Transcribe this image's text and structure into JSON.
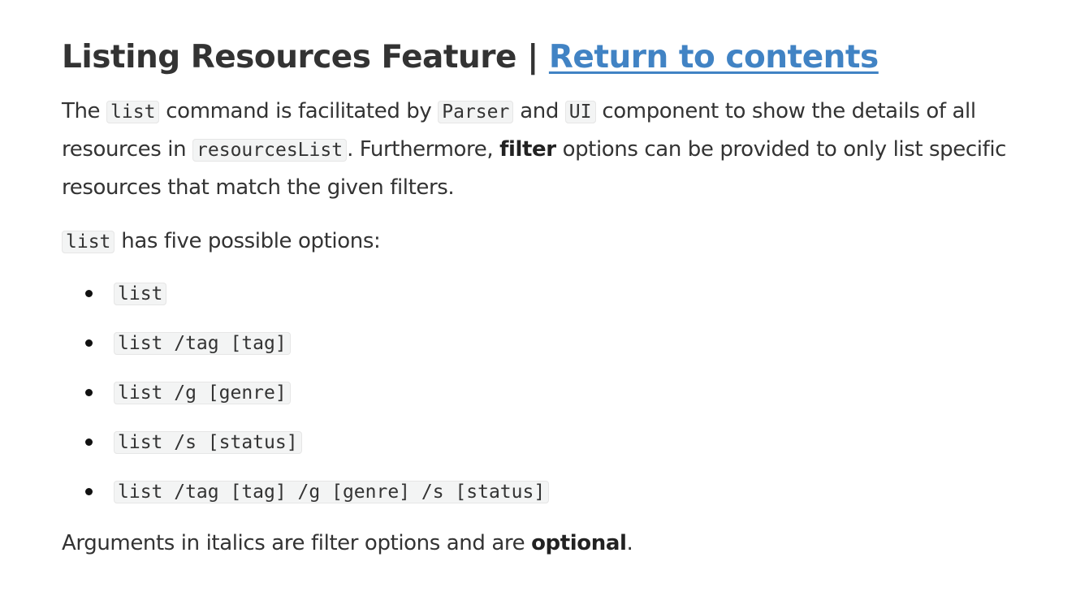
{
  "heading": {
    "title": "Listing Resources Feature",
    "separator": "|",
    "link": "Return to contents"
  },
  "intro": {
    "t1": "The ",
    "c1": "list",
    "t2": " command is facilitated by ",
    "c2": "Parser",
    "t3": " and ",
    "c3": "UI",
    "t4": " component to show the details of all resources in ",
    "c4": "resourcesList",
    "t5": ". Furthermore, ",
    "b1": "filter",
    "t6": " options can be provided to only list specific resources that match the given filters."
  },
  "options_intro": {
    "c1": "list",
    "t1": " has five possible options:"
  },
  "options": [
    "list",
    "list /tag [tag]",
    "list /g [genre]",
    "list /s [status]",
    "list /tag [tag] /g [genre] /s [status]"
  ],
  "note": {
    "t1": "Arguments in italics are filter options and are ",
    "b1": "optional",
    "t2": "."
  }
}
